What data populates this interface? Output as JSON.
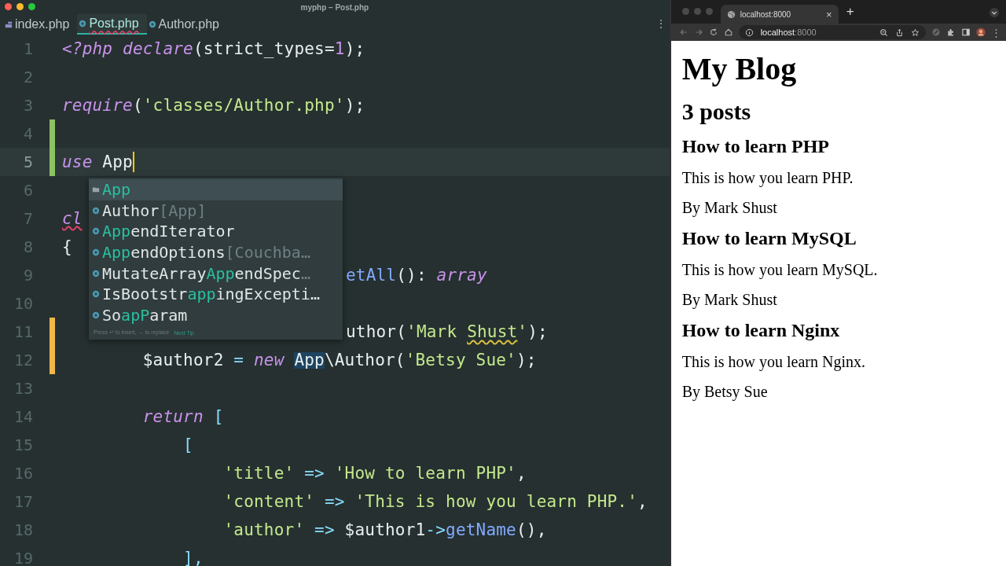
{
  "editor": {
    "title": "myphp – Post.php",
    "more_menu": "⋮",
    "tabs": [
      {
        "label": "index.php",
        "kind": "php",
        "selected": false,
        "has_error": false
      },
      {
        "label": "Post.php",
        "kind": "class",
        "selected": true,
        "has_error": true
      },
      {
        "label": "Author.php",
        "kind": "class",
        "selected": false,
        "has_error": false
      }
    ],
    "lines": [
      {
        "number": "1",
        "added": false,
        "modified": false,
        "current": false,
        "starts_under_popup": false,
        "tokens": [
          {
            "text": "<?php",
            "kind": "keyword"
          },
          {
            "text": " declare",
            "kind": "keyword"
          },
          {
            "text": "(strict_types=",
            "kind": "plain"
          },
          {
            "text": "1",
            "kind": "number"
          },
          {
            "text": ");",
            "kind": "plain"
          }
        ]
      },
      {
        "number": "2",
        "added": false,
        "modified": false,
        "current": false
      },
      {
        "number": "3",
        "added": false,
        "modified": false,
        "current": false,
        "starts_under_popup": false,
        "tokens": [
          {
            "text": "require",
            "kind": "keyword"
          },
          {
            "text": "(",
            "kind": "plain"
          },
          {
            "text": "'classes/Author.php'",
            "kind": "string"
          },
          {
            "text": ");",
            "kind": "plain"
          }
        ]
      },
      {
        "number": "4",
        "added": true,
        "modified": false,
        "current": false
      },
      {
        "number": "5",
        "added": true,
        "modified": false,
        "current": true,
        "starts_under_popup": false,
        "tokens": [
          {
            "text": "use",
            "kind": "keyword"
          },
          {
            "text": " App",
            "kind": "plain"
          }
        ]
      },
      {
        "number": "6",
        "added": false,
        "modified": false,
        "current": false
      },
      {
        "number": "7",
        "added": false,
        "modified": false,
        "current": false,
        "starts_under_popup": false,
        "tokens": [
          {
            "text": "cl",
            "kind": "keyword-error"
          }
        ]
      },
      {
        "number": "8",
        "added": false,
        "modified": false,
        "current": false,
        "starts_under_popup": false,
        "tokens": [
          {
            "text": "{",
            "kind": "plain"
          }
        ]
      },
      {
        "number": "9",
        "added": false,
        "modified": false,
        "current": false,
        "starts_under_popup": true,
        "tokens": [
          {
            "text": "etAll",
            "kind": "function"
          },
          {
            "text": "(): ",
            "kind": "plain"
          },
          {
            "text": "array",
            "kind": "keyword"
          }
        ]
      },
      {
        "number": "10",
        "added": false,
        "modified": false,
        "current": false
      },
      {
        "number": "11",
        "added": false,
        "modified": true,
        "current": false,
        "starts_under_popup": true,
        "tokens": [
          {
            "text": "uthor(",
            "kind": "plain"
          },
          {
            "text": "'Mark ",
            "kind": "string"
          },
          {
            "text": "Shust",
            "kind": "string-typo"
          },
          {
            "text": "'",
            "kind": "string"
          },
          {
            "text": ");",
            "kind": "plain"
          }
        ]
      },
      {
        "number": "12",
        "added": false,
        "modified": true,
        "current": false,
        "starts_under_popup": false,
        "tokens": [
          {
            "text": "        $author2 ",
            "kind": "plain"
          },
          {
            "text": "=",
            "kind": "operator"
          },
          {
            "text": " new ",
            "kind": "keyword"
          },
          {
            "text": "App",
            "kind": "usage-highlight"
          },
          {
            "text": "\\Author(",
            "kind": "plain"
          },
          {
            "text": "'Betsy Sue'",
            "kind": "string"
          },
          {
            "text": ");",
            "kind": "plain"
          }
        ]
      },
      {
        "number": "13",
        "added": false,
        "modified": false,
        "current": false
      },
      {
        "number": "14",
        "added": false,
        "modified": false,
        "current": false,
        "starts_under_popup": false,
        "tokens": [
          {
            "text": "        return",
            "kind": "keyword"
          },
          {
            "text": " [",
            "kind": "operator"
          }
        ]
      },
      {
        "number": "15",
        "added": false,
        "modified": false,
        "current": false,
        "starts_under_popup": false,
        "tokens": [
          {
            "text": "            [",
            "kind": "operator"
          }
        ]
      },
      {
        "number": "16",
        "added": false,
        "modified": false,
        "current": false,
        "starts_under_popup": false,
        "tokens": [
          {
            "text": "                'title'",
            "kind": "string"
          },
          {
            "text": " => ",
            "kind": "operator"
          },
          {
            "text": "'How to learn PHP'",
            "kind": "string"
          },
          {
            "text": ",",
            "kind": "plain"
          }
        ]
      },
      {
        "number": "17",
        "added": false,
        "modified": false,
        "current": false,
        "starts_under_popup": false,
        "tokens": [
          {
            "text": "                'content'",
            "kind": "string"
          },
          {
            "text": " => ",
            "kind": "operator"
          },
          {
            "text": "'This is how you learn PHP.'",
            "kind": "string"
          },
          {
            "text": ",",
            "kind": "plain"
          }
        ]
      },
      {
        "number": "18",
        "added": false,
        "modified": false,
        "current": false,
        "starts_under_popup": false,
        "tokens": [
          {
            "text": "                'author'",
            "kind": "string"
          },
          {
            "text": " => ",
            "kind": "operator"
          },
          {
            "text": "$author1",
            "kind": "plain"
          },
          {
            "text": "->",
            "kind": "operator"
          },
          {
            "text": "getName",
            "kind": "function"
          },
          {
            "text": "(),",
            "kind": "plain"
          }
        ]
      },
      {
        "number": "19",
        "added": false,
        "modified": false,
        "current": false,
        "starts_under_popup": false,
        "tokens": [
          {
            "text": "            ],",
            "kind": "operator"
          }
        ]
      }
    ],
    "completion": {
      "items": [
        {
          "kind": "namespace",
          "selected": true,
          "parts": [
            {
              "text": "App",
              "match": true
            }
          ]
        },
        {
          "kind": "class",
          "selected": false,
          "parts": [
            {
              "text": "Author",
              "match": false
            }
          ],
          "hint": "[App]"
        },
        {
          "kind": "class",
          "selected": false,
          "parts": [
            {
              "text": "App",
              "match": true
            },
            {
              "text": "endIterator",
              "match": false
            }
          ]
        },
        {
          "kind": "class",
          "selected": false,
          "parts": [
            {
              "text": "App",
              "match": true
            },
            {
              "text": "endOptions",
              "match": false
            }
          ],
          "hint": "[Couchba…"
        },
        {
          "kind": "class",
          "selected": false,
          "parts": [
            {
              "text": "MutateArray",
              "match": false
            },
            {
              "text": "App",
              "match": true
            },
            {
              "text": "endSpec",
              "match": false
            }
          ],
          "hint": "…"
        },
        {
          "kind": "class",
          "selected": false,
          "parts": [
            {
              "text": "IsBootstr",
              "match": false
            },
            {
              "text": "app",
              "match": true
            },
            {
              "text": "ingExcepti…",
              "match": false
            }
          ]
        },
        {
          "kind": "class",
          "selected": false,
          "parts": [
            {
              "text": "So",
              "match": false
            },
            {
              "text": "apP",
              "match": true
            },
            {
              "text": "aram",
              "match": false
            }
          ]
        }
      ],
      "footer": "Press ↵ to insert, → to replace",
      "footer_link": "Next Tip"
    }
  },
  "browser": {
    "tab": {
      "title": "localhost:8000",
      "close": "×"
    },
    "new_tab": "+",
    "menu": "⋮",
    "address": {
      "host": "localhost",
      "port": ":8000"
    },
    "page": {
      "title": "My Blog",
      "count": "3 posts",
      "posts": [
        {
          "title": "How to learn PHP",
          "content": "This is how you learn PHP.",
          "byline": "By Mark Shust"
        },
        {
          "title": "How to learn MySQL",
          "content": "This is how you learn MySQL.",
          "byline": "By Mark Shust"
        },
        {
          "title": "How to learn Nginx",
          "content": "This is how you learn Nginx.",
          "byline": "By Betsy Sue"
        }
      ]
    }
  }
}
